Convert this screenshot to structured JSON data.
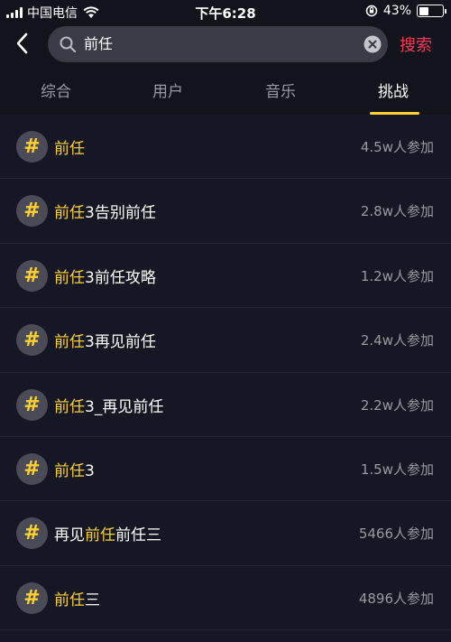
{
  "status_bar": {
    "carrier": "中国电信",
    "time": "下午6:28",
    "battery": "43%",
    "battery_level": 0.43
  },
  "search": {
    "query": "前任",
    "button_label": "搜索"
  },
  "tabs": [
    {
      "label": "综合",
      "active": false
    },
    {
      "label": "用户",
      "active": false
    },
    {
      "label": "音乐",
      "active": false
    },
    {
      "label": "挑战",
      "active": true
    }
  ],
  "results": [
    {
      "pre": "",
      "hl": "前任",
      "post": "",
      "count": "4.5w人参加"
    },
    {
      "pre": "",
      "hl": "前任",
      "post": "3告别前任",
      "count": "2.8w人参加"
    },
    {
      "pre": "",
      "hl": "前任",
      "post": "3前任攻略",
      "count": "1.2w人参加"
    },
    {
      "pre": "",
      "hl": "前任",
      "post": "3再见前任",
      "count": "2.4w人参加"
    },
    {
      "pre": "",
      "hl": "前任",
      "post": "3_再见前任",
      "count": "2.2w人参加"
    },
    {
      "pre": "",
      "hl": "前任",
      "post": "3",
      "count": "1.5w人参加"
    },
    {
      "pre": "再见",
      "hl": "前任",
      "post": "前任三",
      "count": "5466人参加"
    },
    {
      "pre": "",
      "hl": "前任",
      "post": "三",
      "count": "4896人参加"
    }
  ],
  "hash_symbol": "#",
  "colors": {
    "accent_yellow": "#fed12f",
    "search_red": "#f03c5c",
    "background": "#161724"
  }
}
